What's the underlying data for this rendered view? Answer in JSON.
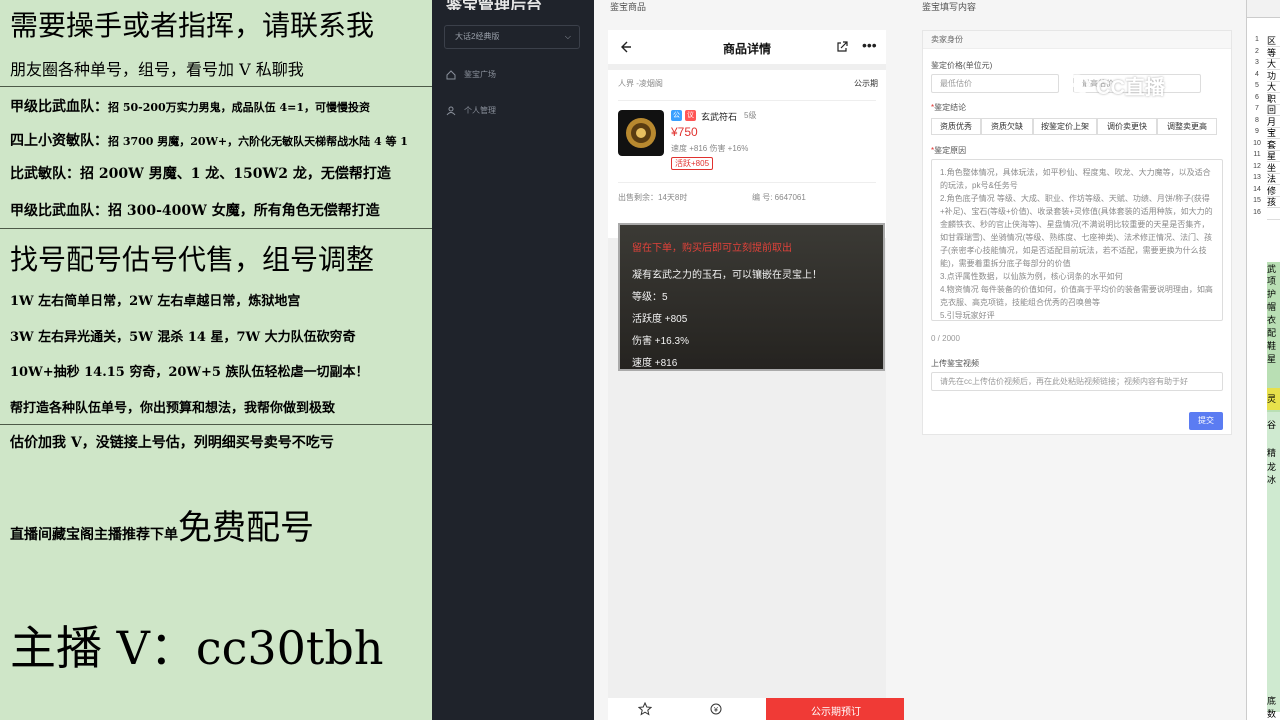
{
  "promo": {
    "line1": "需要操手或者指挥，请联系我",
    "line2": "朋友圈各种单号，组号，看号加 V 私聊我",
    "line3a": "甲级比武血队：",
    "line3b": "招 50-200万实力男鬼，成品队伍 4=1，可慢慢投资",
    "line4a": "四上小资敏队：",
    "line4b": "招 3700 男魔，20W+，六阶化无敏队天梯帮战水陆 4 等 1",
    "line5": "比武敏队：招 200W 男魔、1 龙、150W2 龙，无偿帮打造",
    "line6": "甲级比武血队：招 300-400W 女魔，所有角色无偿帮打造",
    "line7": "找号配号估号代售，组号调整",
    "line8": "1W 左右简单日常，2W 左右卓越日常，炼狱地宫",
    "line9": "3W 左右异光通关，5W 混杀 14 星，7W 大力队伍砍穷奇",
    "line10": "10W+抽秒 14.15 穷奇，20W+5 族队伍轻松虐一切副本！",
    "line11": "帮打造各种队伍单号，你出预算和想法，我帮你做到极致",
    "line12": "估价加我 V，没链接上号估，列明细买号卖号不吃亏",
    "line13a": "直播间藏宝阁主播推荐下单",
    "line13b": "免费配号",
    "line14": "主播 V：cc30tbh"
  },
  "sidebar": {
    "logo": "鉴宝管理后台",
    "version_select": "大话2经典版",
    "nav": [
      {
        "label": "鉴宝广场",
        "icon": "home-icon"
      },
      {
        "label": "个人管理",
        "icon": "user-icon"
      }
    ]
  },
  "preview": {
    "column_title": "鉴宝商品",
    "page_title": "商品详情",
    "location": "人界 -凌烟阁",
    "publicity": "公示期",
    "tag1": "公",
    "tag2": "议",
    "item_name": "玄武符石",
    "item_level": "5级",
    "price": "¥750",
    "stats": "速度 +816  伤害 +16%",
    "hot": "活跃+805",
    "time_left": "出售剩余：14天8时",
    "serial": "编  号: 6647061",
    "tooltip": {
      "warn": "留在下单，购买后即可立刻提前取出",
      "desc": "凝有玄武之力的玉石，可以镶嵌在灵宝上！",
      "level": "等级：5",
      "activity": "活跃度 +805",
      "damage": "伤害 +16.3%",
      "speed": "速度 +816"
    },
    "buy_button": "公示期预订"
  },
  "form": {
    "column_title": "鉴宝填写内容",
    "section": "卖家身份",
    "price_label": "鉴定价格(单位元)",
    "min_placeholder": "最低估价",
    "max_placeholder": "最高估价",
    "conclusion_label": "鉴定结论",
    "options": [
      "资质优秀",
      "资质欠缺",
      "按鉴定价上架",
      "调价卖更快",
      "调整卖更高"
    ],
    "reason_label": "鉴定原因",
    "reason_text": [
      "1.角色整体情况，具体玩法，如平秒仙、程度鬼、吹龙、大力魔等，以及适合的玩法，pk号&任务号",
      "2.角色底子情况 等级、大成、职业、作坊等级、天赋、功绩、月饼/称子(获得+补足)、宝石(等级+价值)、收录套装+灵修值(具体套装的适用种族，如大力的金麟铁衣、秒的官止侠海等)、星盘情况(不满说明比较重要的天星是否集齐，如甘霖瑞雪)、坐骑情况(等级、熟练度、七座神类)、法术修正情况、法门、孩子(亲密孝心技能情况，如是否适配目前玩法，若不适配，需要更换为什么技能)，需要着重拆分底子每部分的价值",
      "3.点评属性数据，以仙族为例，核心词条的水平如何",
      "4.物资情况 每件装备的价值如何，价值高于平均价的装备需要说明理由，如高克衣服、高克项链，技能组合优秀的召唤兽等",
      "5.引导玩家好评"
    ],
    "counter": "0 / 2000",
    "video_label": "上传鉴宝视频",
    "video_placeholder": "请先在cc上传估价视频后，再在此处粘贴视频链接；视频内容有助于好",
    "submit": "提交"
  },
  "watermark": "CC直播",
  "sheet": {
    "rows": [
      "1",
      "2",
      "3",
      "4",
      "5",
      "6",
      "7",
      "8",
      "9",
      "10",
      "11",
      "12",
      "13",
      "14",
      "15",
      "16"
    ],
    "cells": [
      "区",
      "等",
      "大",
      "功",
      "大",
      "职",
      "回",
      "月",
      "宝",
      "套",
      "星",
      "坐",
      "法",
      "修",
      "孩",
      ""
    ],
    "lower_cells": [
      "武",
      "项",
      "护",
      "帽",
      "衣",
      "配",
      "鞋",
      "星",
      "灵",
      "谷",
      "精",
      "龙",
      "冰",
      "底",
      "数"
    ]
  }
}
